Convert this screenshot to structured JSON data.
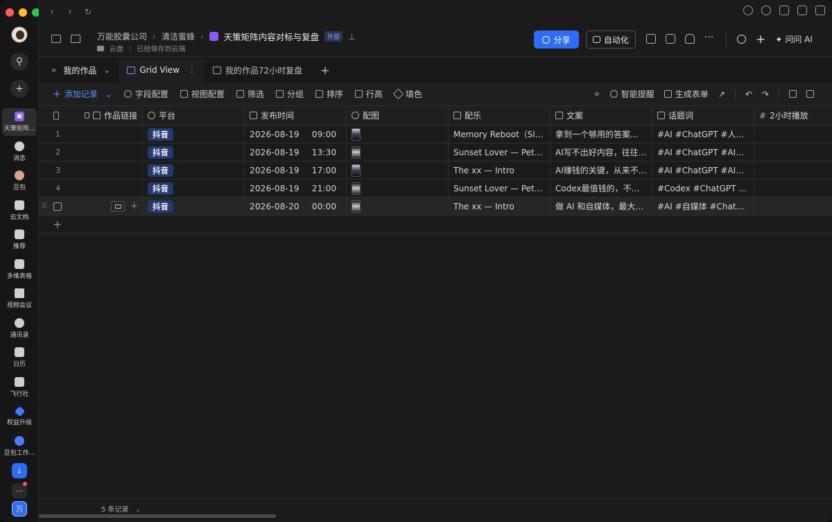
{
  "window": {
    "traffic_colors": [
      "#ff5f57",
      "#febc2e",
      "#28c840"
    ]
  },
  "rail": {
    "items": [
      {
        "label": "天策矩阵...",
        "icon": "doc-icon",
        "active": true
      },
      {
        "label": "消息",
        "icon": "message-icon"
      },
      {
        "label": "豆包",
        "icon": "doubao-icon"
      },
      {
        "label": "云文档",
        "icon": "cloud-doc-icon"
      },
      {
        "label": "推荐",
        "icon": "recommend-icon"
      },
      {
        "label": "多维表格",
        "icon": "base-icon"
      },
      {
        "label": "视频会议",
        "icon": "video-icon"
      },
      {
        "label": "通讯录",
        "icon": "contacts-icon"
      },
      {
        "label": "日历",
        "icon": "calendar-icon"
      },
      {
        "label": "飞行社",
        "icon": "flight-icon"
      },
      {
        "label": "权益升级",
        "icon": "diamond-icon"
      },
      {
        "label": "豆包工作...",
        "icon": "doubao-work-icon"
      }
    ],
    "bottom_workspace": "万"
  },
  "header": {
    "breadcrumb": [
      "万能胶囊公司",
      "清洁蜜蜂",
      "天策矩阵内容对标与复盘"
    ],
    "external_badge": "外部",
    "location": "云盘",
    "save_status": "已经保存到云端",
    "share_label": "分享",
    "automation_label": "自动化",
    "ask_ai_label": "问问 AI"
  },
  "tabs": {
    "workspace": "我的作品",
    "items": [
      {
        "label": "Grid View",
        "active": true
      },
      {
        "label": "我的作品72小时复盘",
        "active": false
      }
    ]
  },
  "toolbar": {
    "add_record": "添加记录",
    "field_config": "字段配置",
    "view_config": "视图配置",
    "filter": "筛选",
    "group": "分组",
    "sort": "排序",
    "row_height": "行高",
    "fill": "填色",
    "smart_remind": "智能提醒",
    "generate_form": "生成表单"
  },
  "table": {
    "columns": [
      "作品链接",
      "平台",
      "发布时间",
      "配图",
      "配乐",
      "文案",
      "话题词",
      "2小时播放"
    ],
    "rows": [
      {
        "num": "1",
        "platform": "抖音",
        "date": "2026-08-19",
        "time": "09:00",
        "music": "Memory Reboot（Slowed）",
        "copy": "拿到一个够用的答案，就以为自己懂了",
        "tags": "#AI #ChatGPT #人工智能",
        "thumb": "a"
      },
      {
        "num": "2",
        "platform": "抖音",
        "date": "2026-08-19",
        "time": "13:30",
        "music": "Sunset Lover — Petit Biscuit",
        "copy": "AI写不出好内容，往往不是工具问题",
        "tags": "#AI #ChatGPT #AI写作",
        "thumb": "b"
      },
      {
        "num": "3",
        "platform": "抖音",
        "date": "2026-08-19",
        "time": "17:00",
        "music": "The xx — Intro",
        "copy": "AI赚钱的关键，从来不是工具本身",
        "tags": "#AI #ChatGPT #AI赚钱",
        "thumb": "a"
      },
      {
        "num": "4",
        "platform": "抖音",
        "date": "2026-08-19",
        "time": "21:00",
        "music": "Sunset Lover — Petit Biscuit",
        "copy": "Codex最值钱的，不是写代码",
        "tags": "#Codex #ChatGPT #AI",
        "thumb": "b"
      },
      {
        "num": "5",
        "platform": "抖音",
        "date": "2026-08-20",
        "time": "00:00",
        "music": "The xx — Intro",
        "copy": "做 AI 和自媒体，最大的坑",
        "tags": "#AI #自媒体 #ChatGPT",
        "thumb": "b"
      }
    ]
  },
  "footer": {
    "record_count": "5 条记录"
  }
}
